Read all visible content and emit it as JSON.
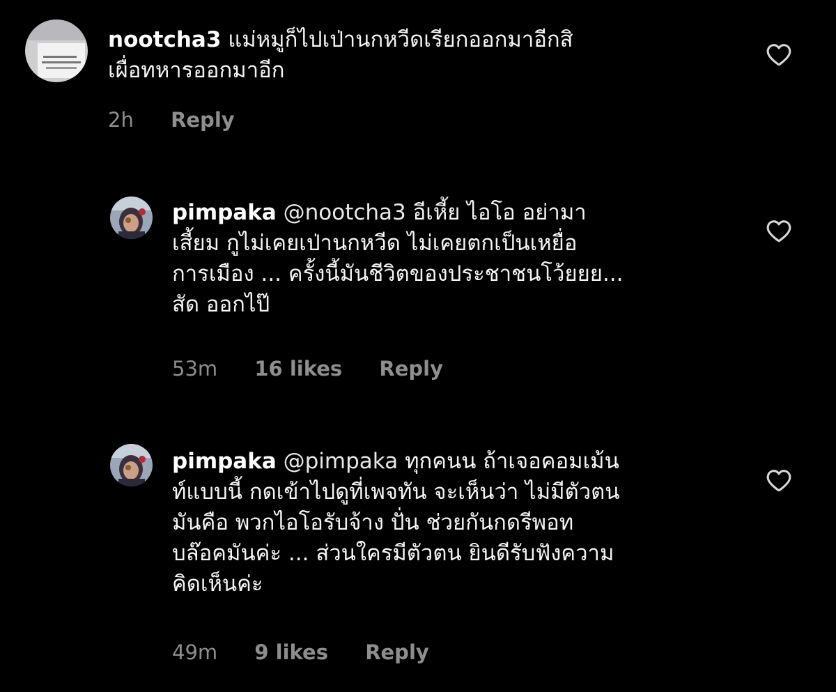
{
  "comments": [
    {
      "username": "nootcha3",
      "mention": "",
      "lines": [
        "แม่หมูก็ไปเป่านกหวีดเรียกออกมาอีกสิ",
        "เผื่อทหารออกมาอีก"
      ],
      "time": "2h",
      "likes": "",
      "reply_label": "Reply"
    },
    {
      "username": "pimpaka",
      "mention": "@nootcha3",
      "lines": [
        "อีเหี้ย ไอโอ อย่ามา",
        "เสี้ยม กูไม่เคยเป่านกหวีด ไม่เคยตกเป็นเหยื่อ",
        "การเมือง ... ครั้งนี้มันชีวิตของประชาชนโว้ยยย...",
        "สัด ออกไป๊"
      ],
      "time": "53m",
      "likes": "16 likes",
      "reply_label": "Reply"
    },
    {
      "username": "pimpaka",
      "mention": "@pimpaka",
      "lines": [
        "ทุกคนน  ถ้าเจอคอมเม้น",
        "ท์แบบนี้ กดเข้าไปดูที่เพจทัน จะเห็นว่า ไม่มีตัวตน",
        "มันคือ พวกไอโอรับจ้าง ปั่น ช่วยกันกดรีพอท",
        "บล๊อคมันค่ะ ... ส่วนใครมีตัวตน ยินดีรับฟังความ",
        "คิดเห็นค่ะ"
      ],
      "time": "49m",
      "likes": "9 likes",
      "reply_label": "Reply"
    }
  ],
  "icons": {
    "like": "heart-outline-icon"
  },
  "colors": {
    "background": "#000000",
    "text": "#f5f5f5",
    "secondary": "#8e8e8e"
  }
}
